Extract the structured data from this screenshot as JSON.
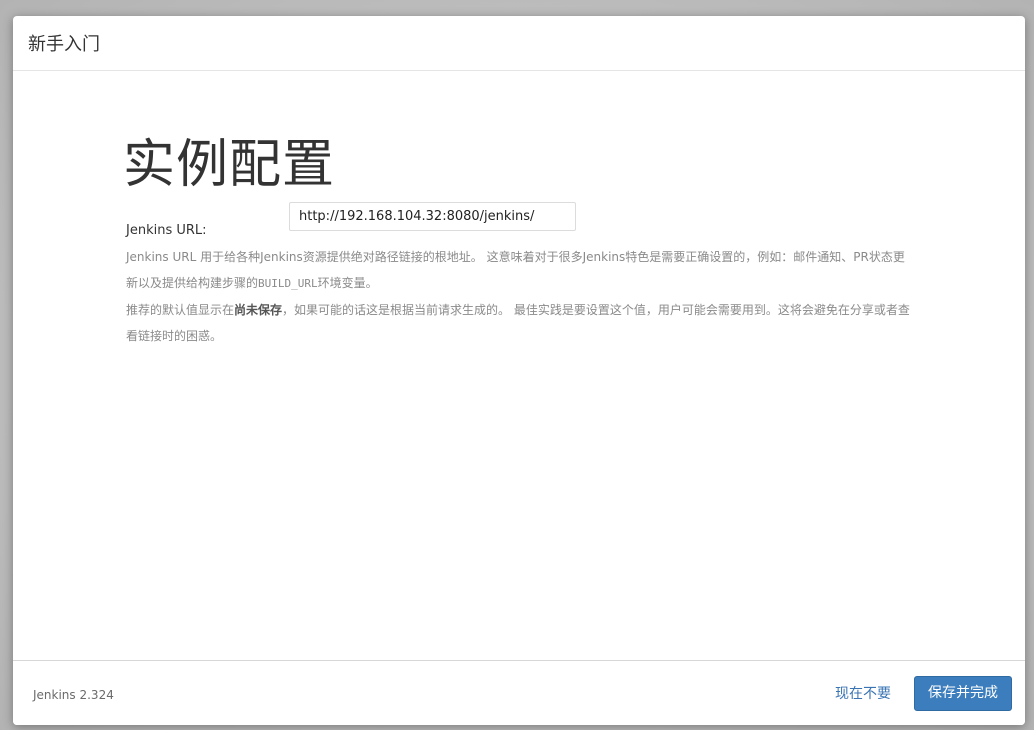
{
  "dialog": {
    "title": "新手入门"
  },
  "main": {
    "heading": "实例配置",
    "url_label": "Jenkins URL:",
    "url_value": "http://192.168.104.32:8080/jenkins/",
    "help_line1_part1": "Jenkins URL 用于给各种Jenkins资源提供绝对路径链接的根地址。 这意味着对于很多Jenkins特色是需要正确设置的，例如：邮件通知、PR状态更新以及提供给构建步骤的",
    "help_line1_code": "BUILD_URL",
    "help_line1_part2": "环境变量。",
    "help_line2_part1": "推荐的默认值显示在",
    "help_line2_strong": "尚未保存",
    "help_line2_part2": "，如果可能的话这是根据当前请求生成的。 最佳实践是要设置这个值，用户可能会需要用到。这将会避免在分享或者查看链接时的困惑。"
  },
  "footer": {
    "version": "Jenkins 2.324",
    "skip_label": "现在不要",
    "save_label": "保存并完成"
  },
  "colors": {
    "primary_button": "#3c7dbd",
    "link": "#3a74b3",
    "help_text": "#8a8a8a"
  }
}
